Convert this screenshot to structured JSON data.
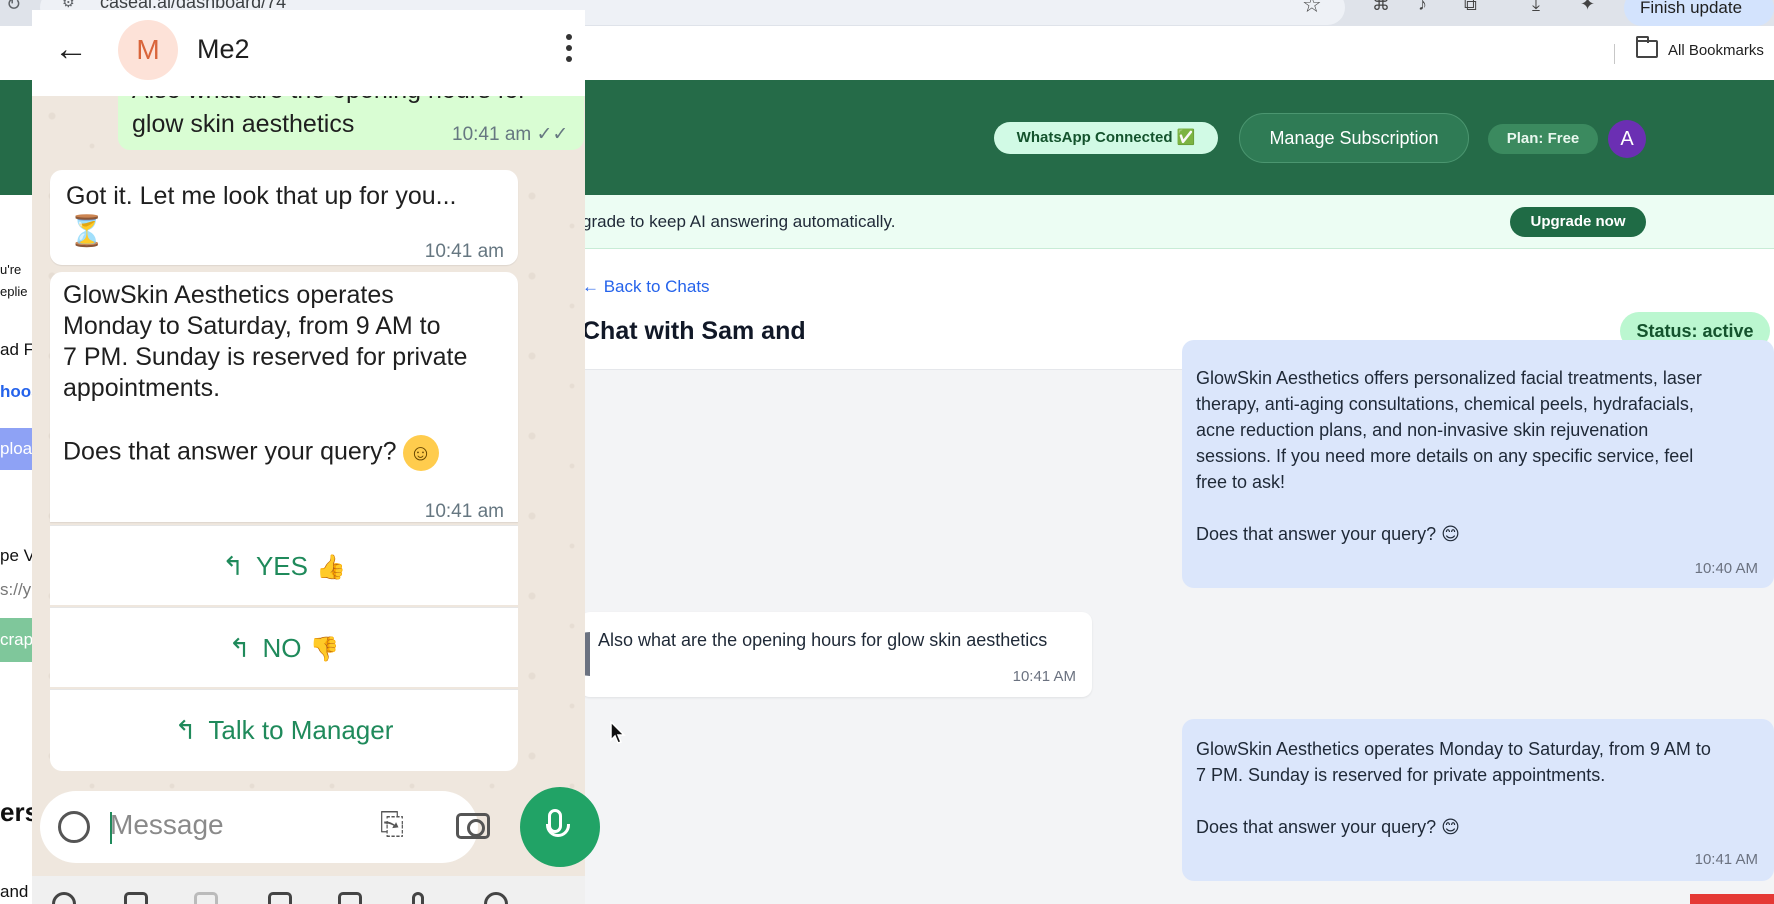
{
  "browser": {
    "url": "caseai.ai/dashboard/74",
    "finish_update": "Finish update",
    "all_bookmarks": "All Bookmarks"
  },
  "dashboard": {
    "whatsapp_status": "WhatsApp Connected ✅",
    "manage_subscription": "Manage Subscription",
    "plan": "Plan: Free",
    "avatar_initial": "A",
    "notice_text": "grade to keep AI answering automatically.",
    "upgrade_button": "Upgrade now",
    "back_link": "← Back to Chats",
    "chat_title": "Chat with Sam and",
    "status": "Status: active",
    "left_strip": [
      "u're",
      "eplie",
      "ad F",
      "hoos",
      "ploa",
      "pe V",
      "s://y",
      "crap",
      "ers",
      "and"
    ],
    "messages": [
      {
        "lines": [
          "GlowSkin Aesthetics offers personalized facial treatments, laser",
          "therapy, anti-aging consultations, chemical peels, hydrafacials,",
          "acne reduction plans, and non-invasive skin rejuvenation",
          "sessions. If you need more details on any specific service, feel",
          "free to ask!"
        ],
        "question": "Does that answer your query? 😊",
        "time": "10:40 AM"
      },
      {
        "text": "Also what are the opening hours for glow skin aesthetics",
        "time": "10:41 AM"
      },
      {
        "lines": [
          "GlowSkin Aesthetics operates Monday to Saturday, from 9 AM to",
          "7 PM. Sunday is reserved for private appointments."
        ],
        "question": "Does that answer your query? 😊",
        "time": "10:41 AM"
      }
    ]
  },
  "whatsapp": {
    "contact_initial": "M",
    "contact_name": "Me2",
    "sent_cut": "Also what are the opening hours for",
    "sent_text": "glow skin aesthetics",
    "sent_time": "10:41 am",
    "recv1_text": "Got it. Let me look that up for you...",
    "recv1_time": "10:41 am",
    "recv2_lines": [
      "GlowSkin Aesthetics operates",
      "Monday to Saturday, from 9 AM to",
      "7 PM. Sunday is reserved for private",
      "appointments."
    ],
    "recv2_question": "Does that answer your query?",
    "recv2_time": "10:41 am",
    "btn_yes": "YES",
    "btn_no": "NO",
    "btn_manager": "Talk to Manager",
    "input_placeholder": "Message"
  }
}
